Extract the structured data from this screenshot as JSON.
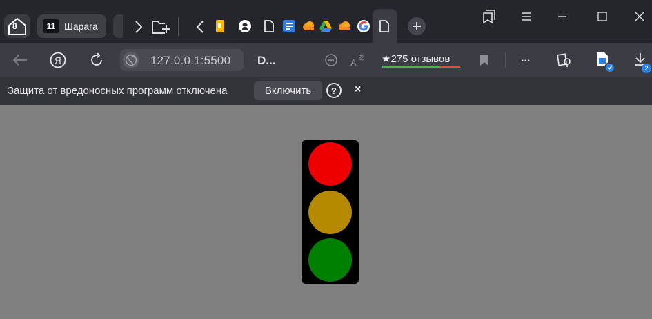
{
  "tabstrip": {
    "home_count": "8",
    "group": {
      "count": "11",
      "label": "Шарага"
    },
    "favicons": [
      "yellow-doc-icon",
      "github-icon",
      "page-icon",
      "blue-list-icon",
      "orange-cloud-icon",
      "google-drive-icon",
      "orange-cloud-icon",
      "google-icon"
    ],
    "active_tab_icon": "page-icon"
  },
  "toolbar": {
    "url": "127.0.0.1:5500",
    "page_title": "D...",
    "reviews": "★275 отзывов",
    "more": "...",
    "download_count": "2"
  },
  "infobar": {
    "message": "Защита от вредоносных программ отключена",
    "enable_label": "Включить",
    "help": "?",
    "close": "×"
  },
  "traffic_light": {
    "housing_color": "#000000",
    "lamps": [
      {
        "name": "red",
        "color": "#ee0000"
      },
      {
        "name": "yellow",
        "color": "#b58a00"
      },
      {
        "name": "green",
        "color": "#008000"
      }
    ]
  },
  "colors": {
    "page_background": "#808080",
    "chrome_dark": "#25262b",
    "toolbar": "#3c3d44",
    "accent_blue": "#2a83e6"
  }
}
